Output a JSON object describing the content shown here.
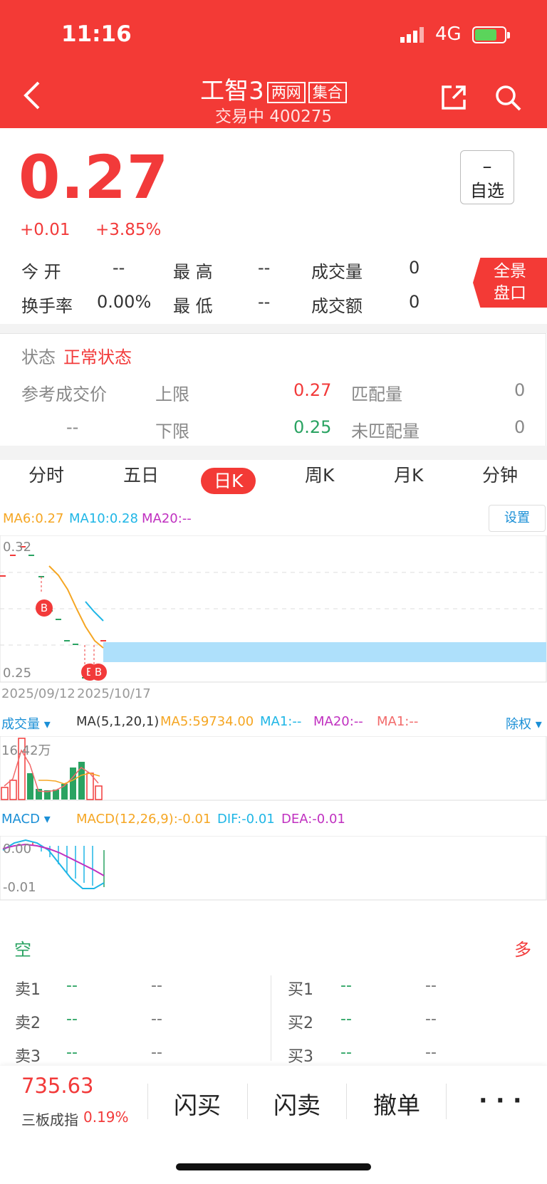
{
  "status": {
    "time": "11:16",
    "network": "4G"
  },
  "header": {
    "name": "工智3",
    "tag1": "两网",
    "tag2": "集合",
    "sub": "交易中 400275"
  },
  "quote": {
    "price": "0.27",
    "change": "+0.01",
    "change_pct": "+3.85%",
    "watch_symbol": "–",
    "watch_label": "自选",
    "open_label": "今  开",
    "open": "--",
    "high_label": "最  高",
    "high": "--",
    "vol_label": "成交量",
    "vol": "0",
    "turn_label": "换手率",
    "turn": "0.00%",
    "low_label": "最  低",
    "low": "--",
    "amt_label": "成交额",
    "amt": "0",
    "panorama_1": "全景",
    "panorama_2": "盘口"
  },
  "auction": {
    "state_label": "状态",
    "state": "正常状态",
    "ref_label": "参考成交价",
    "ref": "--",
    "upper_label": "上限",
    "upper": "0.27",
    "lower_label": "下限",
    "lower": "0.25",
    "match_label": "匹配量",
    "match": "0",
    "unmatch_label": "未匹配量",
    "unmatch": "0"
  },
  "tabs": [
    "分时",
    "五日",
    "日K",
    "周K",
    "月K",
    "分钟"
  ],
  "kline": {
    "ma6": "MA6:0.27",
    "ma10": "MA10:0.28",
    "ma20": "MA20:--",
    "settings": "设置",
    "ymax": "0.32",
    "ymin": "0.25",
    "date1": "2025/09/12",
    "date2": "2025/10/17",
    "marker": "B"
  },
  "volume": {
    "label": "成交量",
    "ma_cfg": "MA(5,1,20,1)",
    "ma5": "MA5:59734.00",
    "ma1": "MA1:--",
    "ma20": "MA20:--",
    "ma1b": "MA1:--",
    "adjust": "除权",
    "ymax": "16.42万"
  },
  "macd": {
    "label": "MACD",
    "cfg": "MACD(12,26,9):-0.01",
    "dif": "DIF:-0.01",
    "dea": "DEA:-0.01",
    "ytop": "0.00",
    "ybottom": "-0.01"
  },
  "orderbook": {
    "empty": "空",
    "full": "多",
    "sell": [
      {
        "label": "卖1",
        "price": "--",
        "vol": "--"
      },
      {
        "label": "卖2",
        "price": "--",
        "vol": "--"
      },
      {
        "label": "卖3",
        "price": "--",
        "vol": "--"
      }
    ],
    "buy": [
      {
        "label": "买1",
        "price": "--",
        "vol": "--"
      },
      {
        "label": "买2",
        "price": "--",
        "vol": "--"
      },
      {
        "label": "买3",
        "price": "--",
        "vol": "--"
      }
    ]
  },
  "footer": {
    "index_value": "735.63",
    "index_name": "三板成指",
    "index_pct": "0.19%",
    "flash_buy": "闪买",
    "flash_sell": "闪卖",
    "cancel": "撤单",
    "more": "· · ·"
  },
  "colors": {
    "brand": "#f33a36",
    "up": "#f23a3a",
    "down": "#2aa362",
    "ma6": "#f5a623",
    "ma10": "#1fb6e6",
    "ma20": "#c030c0"
  }
}
